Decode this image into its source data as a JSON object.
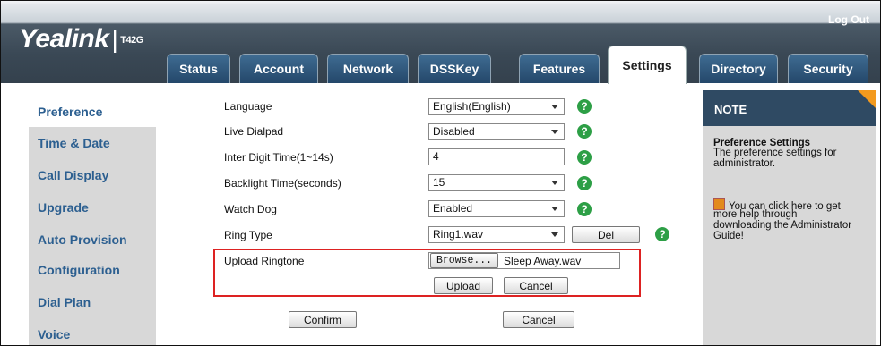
{
  "header": {
    "logout": "Log Out",
    "logo_brand": "Yealink",
    "logo_model": "T42G"
  },
  "tabs": [
    {
      "label": "Status"
    },
    {
      "label": "Account"
    },
    {
      "label": "Network"
    },
    {
      "label": "DSSKey"
    },
    {
      "label": "Features"
    },
    {
      "label": "Settings",
      "active": true
    },
    {
      "label": "Directory"
    },
    {
      "label": "Security"
    }
  ],
  "sidebar": {
    "items": [
      {
        "label": "Preference",
        "active": true
      },
      {
        "label": "Time & Date"
      },
      {
        "label": "Call Display"
      },
      {
        "label": "Upgrade"
      },
      {
        "label": "Auto Provision"
      },
      {
        "label": "Configuration"
      },
      {
        "label": "Dial Plan"
      },
      {
        "label": "Voice"
      }
    ]
  },
  "form": {
    "language": {
      "label": "Language",
      "value": "English(English)"
    },
    "live_dialpad": {
      "label": "Live Dialpad",
      "value": "Disabled"
    },
    "inter_digit": {
      "label": "Inter Digit Time(1~14s)",
      "value": "4"
    },
    "backlight": {
      "label": "Backlight Time(seconds)",
      "value": "15"
    },
    "watch_dog": {
      "label": "Watch Dog",
      "value": "Enabled"
    },
    "ring_type": {
      "label": "Ring Type",
      "value": "Ring1.wav",
      "del_label": "Del"
    },
    "upload_ringtone": {
      "label": "Upload Ringtone",
      "browse_label": "Browse...",
      "file_name": "Sleep Away.wav",
      "upload_label": "Upload",
      "cancel_label": "Cancel"
    },
    "confirm_label": "Confirm",
    "cancel_label": "Cancel"
  },
  "note": {
    "title": "NOTE",
    "heading": "Preference Settings",
    "line1": "The preference settings for",
    "line2": "administrator.",
    "help1": "You can click here to get",
    "help2": "more help through",
    "help3": "downloading the Administrator",
    "help4": "Guide!"
  },
  "colors": {
    "accent_tab": "#2f5780",
    "sidebar_text": "#2c5f90",
    "help_icon": "#2d9f46",
    "highlight_box": "#dd2222",
    "note_corner": "#f39a1e"
  }
}
